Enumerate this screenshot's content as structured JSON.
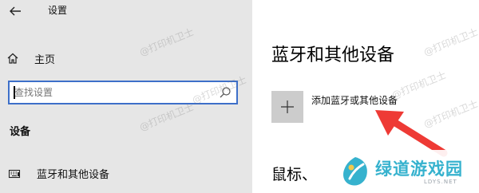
{
  "window": {
    "title": "设置"
  },
  "nav": {
    "home_label": "主页",
    "search": {
      "placeholder": "查找设置",
      "value": ""
    },
    "section_label": "设备",
    "items": [
      {
        "label": "蓝牙和其他设备"
      }
    ]
  },
  "main": {
    "page_title": "蓝牙和其他设备",
    "add_device_label": "添加蓝牙或其他设备",
    "next_section_partial": "鼠标、"
  },
  "watermark": {
    "text": "@打印机卫士"
  },
  "logo": {
    "name": "绿道游戏园",
    "domain": "LDYS.NET"
  },
  "colors": {
    "nav_background": "#e6e6e6",
    "search_border": "#3d6fc9",
    "add_tile": "#cccccc",
    "annotation_arrow": "#ee3a35",
    "logo_text": "#36b2ce"
  },
  "icons": {
    "back": "back-arrow-icon",
    "home": "home-icon",
    "search": "search-icon",
    "add": "plus-icon",
    "bluetooth_devices": "keyboard-device-icon"
  }
}
